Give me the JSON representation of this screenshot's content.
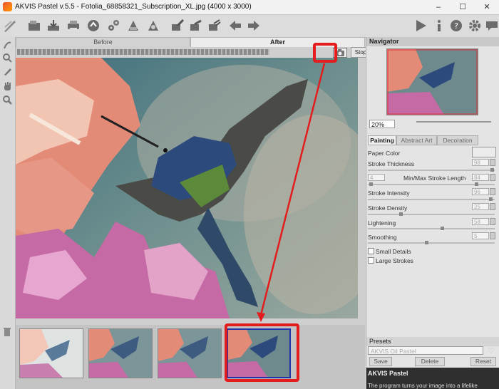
{
  "window": {
    "title": "AKVIS Pastel v.5.5 - Fotolia_68858321_Subscription_XL.jpg (4000 x 3000)",
    "minimize": "–",
    "maximize": "☐",
    "close": "✕"
  },
  "toolbar": {
    "icons": [
      "open-icon",
      "save-icon",
      "print-icon",
      "share-icon",
      "settings-icon",
      "batch-icon",
      "preferences-icon",
      "history-icon",
      "paint-icon",
      "frame-icon",
      "undo-icon",
      "redo-icon",
      "run-icon",
      "info-icon",
      "help-icon",
      "gear-icon",
      "chat-icon"
    ]
  },
  "view_tabs": {
    "before": "Before",
    "after": "After"
  },
  "processing": {
    "stop": "Stop",
    "progress": 0.85
  },
  "navigator": {
    "title": "Navigator",
    "zoom": "20%"
  },
  "settings_tabs": [
    "Painting",
    "Abstract Art",
    "Decoration"
  ],
  "settings": {
    "paper_color": "Paper Color",
    "stroke_thickness": {
      "label": "Stroke Thickness",
      "value": "98"
    },
    "min_max_stroke_length": {
      "label": "Min/Max Stroke Length",
      "min": "4",
      "max": "84"
    },
    "stroke_intensity": {
      "label": "Stroke Intensity",
      "value": "96"
    },
    "stroke_density": {
      "label": "Stroke Density",
      "value": "25"
    },
    "lightening": {
      "label": "Lightening",
      "value": "58"
    },
    "smoothing": {
      "label": "Smoothing",
      "value": "5"
    },
    "small_details": "Small Details",
    "large_strokes": "Large Strokes"
  },
  "presets": {
    "title": "Presets",
    "selected": "AKVIS Oil Pastel",
    "save": "Save",
    "delete": "Delete",
    "reset": "Reset"
  },
  "help": {
    "title": "AKVIS Pastel",
    "text": "The program turns your image into a lifelike"
  },
  "colors": {
    "highlight": "#e31d1d",
    "selection": "#2233aa"
  }
}
